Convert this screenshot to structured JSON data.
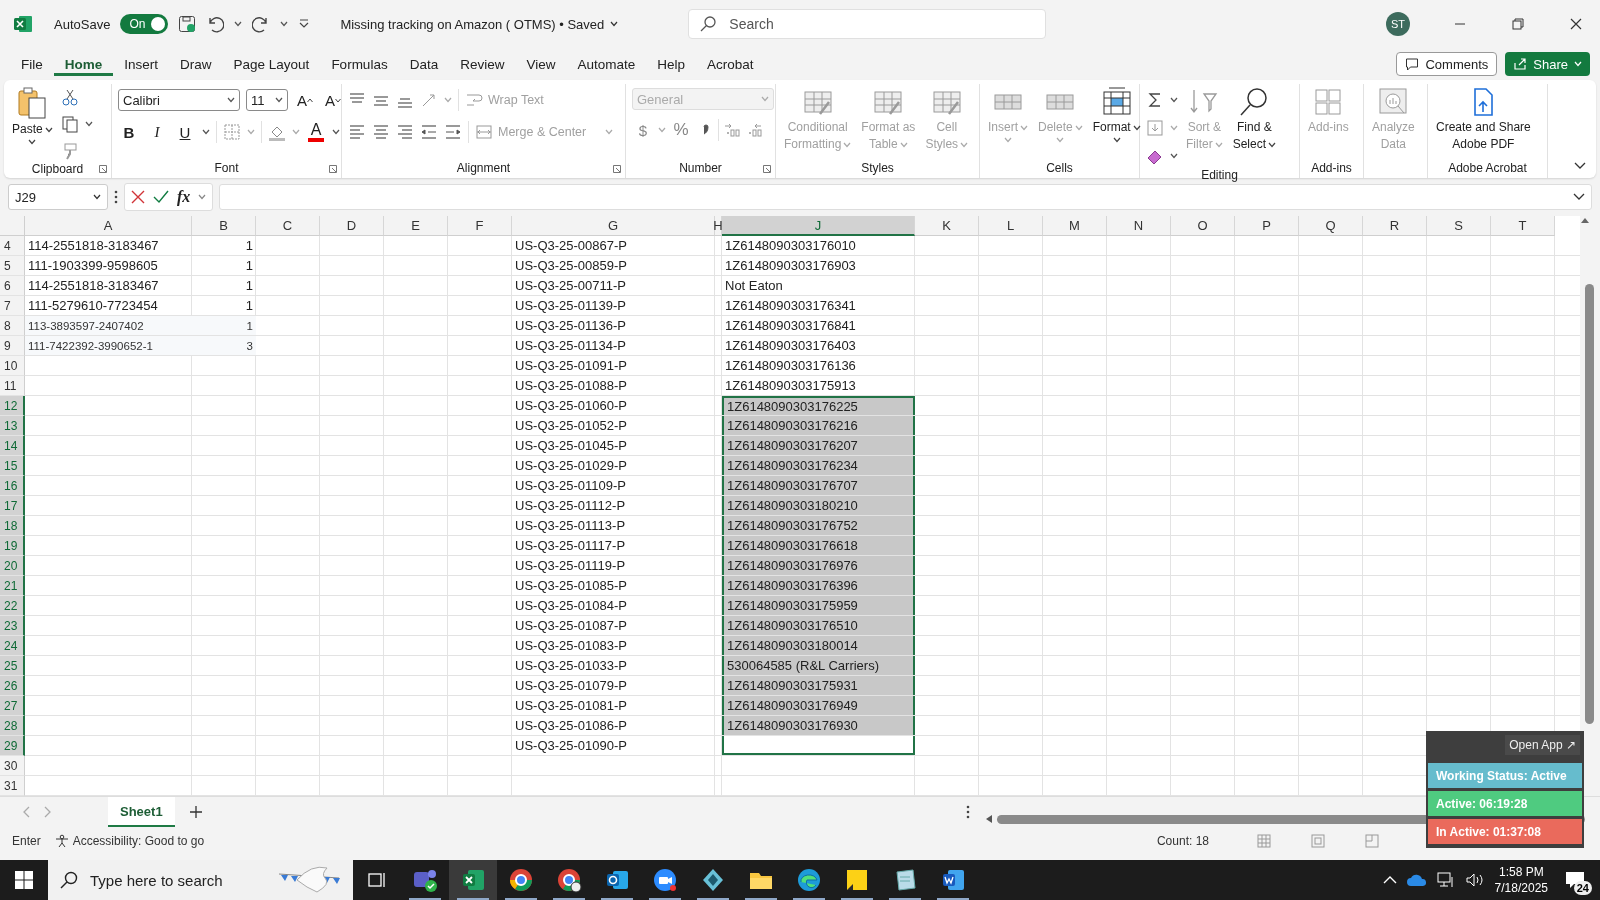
{
  "title_bar": {
    "autosave_label": "AutoSave",
    "autosave_on": true,
    "autosave_state": "On",
    "document_title": "Missing tracking on Amazon ( OTMS) • Saved",
    "search_placeholder": "Search",
    "avatar": "ST"
  },
  "menu_tabs": [
    {
      "label": "File",
      "selected": false
    },
    {
      "label": "Home",
      "selected": true
    },
    {
      "label": "Insert",
      "selected": false
    },
    {
      "label": "Draw",
      "selected": false
    },
    {
      "label": "Page Layout",
      "selected": false
    },
    {
      "label": "Formulas",
      "selected": false
    },
    {
      "label": "Data",
      "selected": false
    },
    {
      "label": "Review",
      "selected": false
    },
    {
      "label": "View",
      "selected": false
    },
    {
      "label": "Automate",
      "selected": false
    },
    {
      "label": "Help",
      "selected": false
    },
    {
      "label": "Acrobat",
      "selected": false
    }
  ],
  "comments_button": "Comments",
  "share_button": "Share",
  "ribbon": [
    {
      "kind": "clipboard",
      "title": "Clipboard",
      "items": [
        {
          "lines": [
            "Paste"
          ],
          "disabled": false
        }
      ]
    },
    {
      "kind": "font",
      "title": "Font",
      "font_name": "Calibri",
      "font_size": "11",
      "size_buttons": [
        "A",
        "A"
      ],
      "style_buttons": [
        "B",
        "I",
        "U"
      ],
      "font_color_button": "A"
    },
    {
      "kind": "alignment",
      "title": "Alignment",
      "items": [
        {
          "lines": [
            "Wrap Text"
          ],
          "disabled": true
        },
        {
          "lines": [
            "Merge & Center"
          ],
          "disabled": true
        }
      ]
    },
    {
      "kind": "number",
      "title": "Number",
      "format": "General",
      "format_disabled": true,
      "symbols": [
        "$",
        "%"
      ]
    },
    {
      "kind": "styles",
      "title": "Styles",
      "items": [
        {
          "lines": [
            "Conditional",
            "Formatting"
          ],
          "disabled": true
        },
        {
          "lines": [
            "Format as",
            "Table"
          ],
          "disabled": true
        },
        {
          "lines": [
            "Cell",
            "Styles"
          ],
          "disabled": true
        }
      ]
    },
    {
      "kind": "cells",
      "title": "Cells",
      "items": [
        {
          "lines": [
            "Insert"
          ],
          "disabled": true
        },
        {
          "lines": [
            "Delete"
          ],
          "disabled": true
        },
        {
          "lines": [
            "Format"
          ],
          "disabled": false
        }
      ]
    },
    {
      "kind": "editing",
      "title": "Editing",
      "items": [
        {
          "lines": [
            "Sort &",
            "Filter"
          ],
          "disabled": true
        },
        {
          "lines": [
            "Find &",
            "Select"
          ],
          "disabled": false
        }
      ]
    },
    {
      "kind": "addins",
      "title": "Add-ins",
      "items": [
        {
          "lines": [
            "Add-ins"
          ],
          "disabled": true
        }
      ]
    },
    {
      "kind": "analyze",
      "items": [
        {
          "lines": [
            "Analyze",
            "Data"
          ],
          "disabled": true
        }
      ]
    },
    {
      "kind": "acrobat",
      "title": "Adobe Acrobat",
      "items": [
        {
          "lines": [
            "Create and Share",
            "Adobe PDF"
          ],
          "disabled": false
        }
      ]
    }
  ],
  "formula_bar": {
    "name_box": "J29",
    "fx": "fx"
  },
  "columns": [
    {
      "label": "A",
      "selected": false
    },
    {
      "label": "B",
      "selected": false
    },
    {
      "label": "C",
      "selected": false
    },
    {
      "label": "D",
      "selected": false
    },
    {
      "label": "E",
      "selected": false
    },
    {
      "label": "F",
      "selected": false
    },
    {
      "label": "G",
      "selected": false
    },
    {
      "label": "H",
      "selected": false
    },
    {
      "label": "J",
      "selected": true
    },
    {
      "label": "K",
      "selected": false
    },
    {
      "label": "L",
      "selected": false
    },
    {
      "label": "M",
      "selected": false
    },
    {
      "label": "N",
      "selected": false
    },
    {
      "label": "O",
      "selected": false
    },
    {
      "label": "P",
      "selected": false
    },
    {
      "label": "Q",
      "selected": false
    },
    {
      "label": "R",
      "selected": false
    },
    {
      "label": "S",
      "selected": false
    },
    {
      "label": "T",
      "selected": false
    }
  ],
  "rows": [
    {
      "num": "4",
      "kind": "normal",
      "selected": false,
      "active": false,
      "a": "114-2551818-3183467",
      "b": "1",
      "g": "US-Q3-25-00867-P",
      "j": "1Z6148090303176010"
    },
    {
      "num": "5",
      "kind": "normal",
      "selected": false,
      "active": false,
      "a": "111-1903399-9598605",
      "b": "1",
      "g": "US-Q3-25-00859-P",
      "j": "1Z6148090303176903"
    },
    {
      "num": "6",
      "kind": "normal",
      "selected": false,
      "active": false,
      "a": "114-2551818-3183467",
      "b": "1",
      "g": "US-Q3-25-00711-P",
      "j": "Not Eaton"
    },
    {
      "num": "7",
      "kind": "normal",
      "selected": false,
      "active": false,
      "a": "111-5279610-7723454",
      "b": "1",
      "g": "US-Q3-25-01139-P",
      "j": "1Z6148090303176341"
    },
    {
      "num": "8",
      "kind": "small",
      "selected": false,
      "active": false,
      "a": "113-3893597-2407402",
      "b": "1",
      "g": "US-Q3-25-01136-P",
      "j": "1Z6148090303176841"
    },
    {
      "num": "9",
      "kind": "small",
      "selected": false,
      "active": false,
      "a": "111-7422392-3990652-1",
      "b": "3",
      "g": "US-Q3-25-01134-P",
      "j": "1Z6148090303176403"
    },
    {
      "num": "10",
      "kind": "normal",
      "selected": false,
      "active": false,
      "g": "US-Q3-25-01091-P",
      "j": "1Z6148090303176136"
    },
    {
      "num": "11",
      "kind": "normal",
      "selected": false,
      "active": false,
      "g": "US-Q3-25-01088-P",
      "j": "1Z6148090303175913"
    },
    {
      "num": "12",
      "kind": "normal",
      "selected": true,
      "active": false,
      "g": "US-Q3-25-01060-P",
      "j": "1Z6148090303176225"
    },
    {
      "num": "13",
      "kind": "normal",
      "selected": true,
      "active": false,
      "g": "US-Q3-25-01052-P",
      "j": "1Z6148090303176216"
    },
    {
      "num": "14",
      "kind": "normal",
      "selected": true,
      "active": false,
      "g": "US-Q3-25-01045-P",
      "j": "1Z6148090303176207"
    },
    {
      "num": "15",
      "kind": "normal",
      "selected": true,
      "active": false,
      "g": "US-Q3-25-01029-P",
      "j": "1Z6148090303176234"
    },
    {
      "num": "16",
      "kind": "normal",
      "selected": true,
      "active": false,
      "g": "US-Q3-25-01109-P",
      "j": "1Z6148090303176707"
    },
    {
      "num": "17",
      "kind": "normal",
      "selected": true,
      "active": false,
      "g": "US-Q3-25-01112-P",
      "j": "1Z6148090303180210"
    },
    {
      "num": "18",
      "kind": "normal",
      "selected": true,
      "active": false,
      "g": "US-Q3-25-01113-P",
      "j": "1Z6148090303176752"
    },
    {
      "num": "19",
      "kind": "normal",
      "selected": true,
      "active": false,
      "g": "US-Q3-25-01117-P",
      "j": "1Z6148090303176618"
    },
    {
      "num": "20",
      "kind": "normal",
      "selected": true,
      "active": false,
      "g": "US-Q3-25-01119-P",
      "j": "1Z6148090303176976"
    },
    {
      "num": "21",
      "kind": "normal",
      "selected": true,
      "active": false,
      "g": "US-Q3-25-01085-P",
      "j": "1Z6148090303176396"
    },
    {
      "num": "22",
      "kind": "normal",
      "selected": true,
      "active": false,
      "g": "US-Q3-25-01084-P",
      "j": "1Z6148090303175959"
    },
    {
      "num": "23",
      "kind": "normal",
      "selected": true,
      "active": false,
      "g": "US-Q3-25-01087-P",
      "j": "1Z6148090303176510"
    },
    {
      "num": "24",
      "kind": "normal",
      "selected": true,
      "active": false,
      "g": "US-Q3-25-01083-P",
      "j": "1Z6148090303180014"
    },
    {
      "num": "25",
      "kind": "normal",
      "selected": true,
      "active": false,
      "g": "US-Q3-25-01033-P",
      "j": "530064585 (R&L Carriers)"
    },
    {
      "num": "26",
      "kind": "normal",
      "selected": true,
      "active": false,
      "g": "US-Q3-25-01079-P",
      "j": "1Z6148090303175931"
    },
    {
      "num": "27",
      "kind": "normal",
      "selected": true,
      "active": false,
      "g": "US-Q3-25-01081-P",
      "j": "1Z6148090303176949"
    },
    {
      "num": "28",
      "kind": "normal",
      "selected": true,
      "active": false,
      "g": "US-Q3-25-01086-P",
      "j": "1Z6148090303176930"
    },
    {
      "num": "29",
      "kind": "normal",
      "selected": false,
      "active": true,
      "g": "US-Q3-25-01090-P"
    },
    {
      "num": "30",
      "kind": "normal",
      "selected": false,
      "active": false
    },
    {
      "num": "31",
      "kind": "normal",
      "selected": false,
      "active": false
    }
  ],
  "sheet_tabs": [
    {
      "label": "Sheet1",
      "selected": true
    }
  ],
  "status_bar": {
    "mode": "Enter",
    "accessibility": "Accessibility: Good to go",
    "count": "Count: 18"
  },
  "tracker_widget": {
    "open_app": "Open App ↗",
    "statuses": [
      {
        "text": "Working Status: Active",
        "color": "#66bccd"
      },
      {
        "text": "Active: 06:19:28",
        "color": "#4fcb80"
      },
      {
        "text": "In Active: 01:37:08",
        "color": "#ea6a5c"
      }
    ]
  },
  "taskbar": {
    "search_placeholder": "Type here to search",
    "apps": [
      {
        "kind": "chat",
        "selected": false
      },
      {
        "kind": "sheet",
        "selected": true
      },
      {
        "kind": "browser",
        "selected": false
      },
      {
        "kind": "browser-profile",
        "selected": false
      },
      {
        "kind": "mail",
        "selected": false
      },
      {
        "kind": "video",
        "selected": false
      },
      {
        "kind": "diamond",
        "selected": false
      },
      {
        "kind": "folder",
        "selected": false
      },
      {
        "kind": "edge",
        "selected": false
      },
      {
        "kind": "note",
        "selected": false
      },
      {
        "kind": "notepad",
        "selected": false
      },
      {
        "kind": "doc",
        "selected": false
      }
    ],
    "time": "1:58 PM",
    "date": "7/18/2025",
    "notifications": "24"
  }
}
